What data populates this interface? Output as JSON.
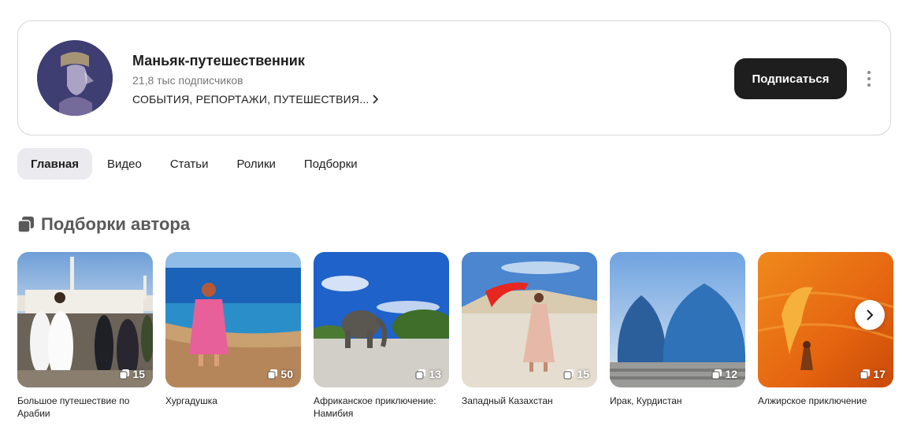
{
  "channel": {
    "name": "Маньяк-путешественник",
    "subscribers": "21,8 тыс подписчиков",
    "description": "СОБЫТИЯ, РЕПОРТАЖИ, ПУТЕШЕСТВИЯ...",
    "subscribe_label": "Подписаться",
    "avatar_icon": "avatar-image",
    "more_icon": "more-vertical-icon"
  },
  "tabs": [
    {
      "label": "Главная",
      "active": true
    },
    {
      "label": "Видео",
      "active": false
    },
    {
      "label": "Статьи",
      "active": false
    },
    {
      "label": "Ролики",
      "active": false
    },
    {
      "label": "Подборки",
      "active": false
    }
  ],
  "section": {
    "title": "Подборки автора",
    "icon": "collections-icon"
  },
  "collections": [
    {
      "title": "Большое путешествие по Арабии",
      "count": "15"
    },
    {
      "title": "Хургадушка",
      "count": "50"
    },
    {
      "title": "Африканское приключение: Намибия",
      "count": "13"
    },
    {
      "title": "Западный Казахстан",
      "count": "15"
    },
    {
      "title": "Ирак, Курдистан",
      "count": "12"
    },
    {
      "title": "Алжирское приключение",
      "count": "17"
    }
  ],
  "colors": {
    "button_bg": "#1e1e1e",
    "active_tab_bg": "#ebebef",
    "card_border": "#d7d7d7"
  }
}
